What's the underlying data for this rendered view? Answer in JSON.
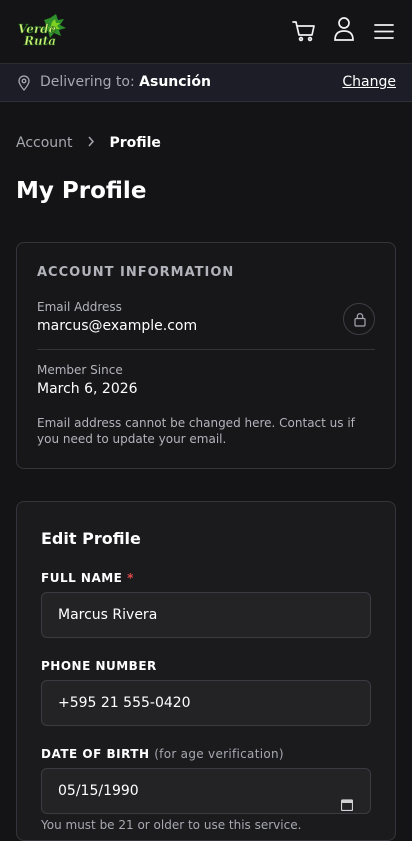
{
  "header": {
    "logo_text": "Verde Ruta",
    "icons": [
      "cart-icon",
      "user-icon",
      "menu-icon"
    ]
  },
  "delivery": {
    "label": "Delivering to: ",
    "city": "Asunción",
    "change_label": "Change"
  },
  "breadcrumb": {
    "parent": "Account",
    "current": "Profile"
  },
  "page_title": "My Profile",
  "account_info": {
    "heading": "ACCOUNT INFORMATION",
    "email_label": "Email Address",
    "email_value": "marcus@example.com",
    "member_label": "Member Since",
    "member_value": "March 6, 2026",
    "note": "Email address cannot be changed here. Contact us if you need to update your email."
  },
  "edit_profile": {
    "title": "Edit Profile",
    "full_name_label": "FULL NAME",
    "required_mark": "*",
    "full_name_value": "Marcus Rivera",
    "phone_label": "PHONE NUMBER",
    "phone_value": "+595 21 555-0420",
    "dob_label": "DATE OF BIRTH",
    "dob_hint": "(for age verification)",
    "dob_value": "05/15/1990",
    "dob_note": "You must be 21 or older to use this service."
  },
  "colors": {
    "background": "#141416",
    "brand_green": "#7ed321",
    "required": "#e24a4a"
  }
}
